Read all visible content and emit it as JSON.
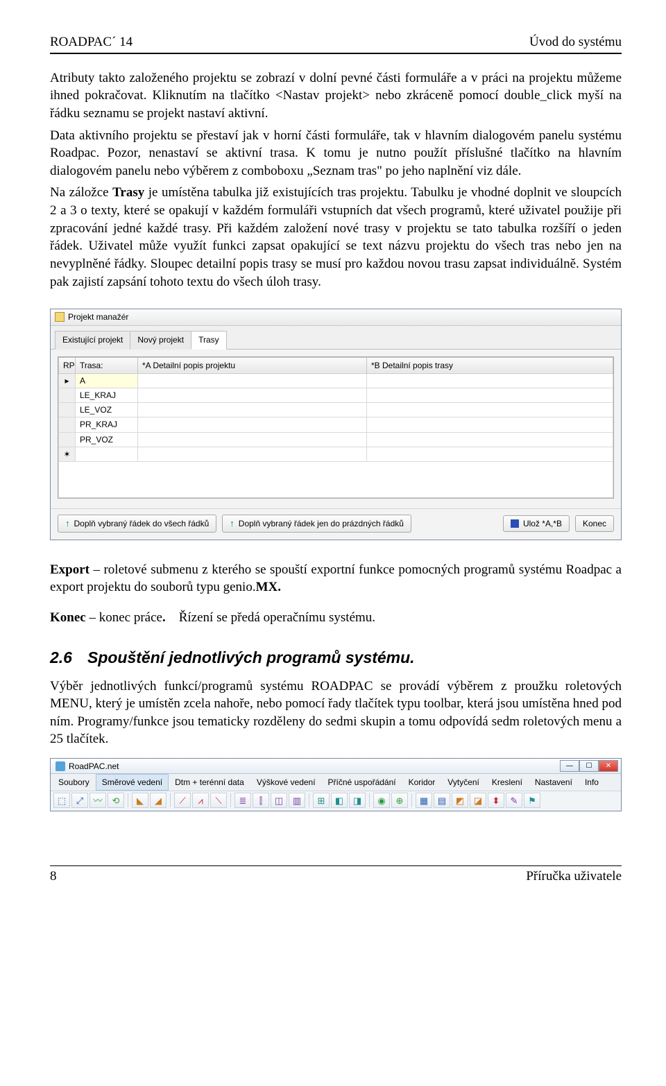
{
  "header": {
    "left": "ROADPAC´ 14",
    "right": "Úvod do systému"
  },
  "paragraphs": {
    "p1": "Atributy takto založeného projektu se zobrazí v dolní pevné části formuláře a v práci na projektu můžeme ihned pokračovat. Kliknutím na tlačítko <Nastav projekt> nebo zkráceně pomocí double_click myší na řádku seznamu se projekt nastaví aktivní.",
    "p2": "Data aktivního projektu se přestaví jak v horní části formuláře, tak v hlavním dialogovém panelu systému Roadpac. Pozor, nenastaví se aktivní trasa. K tomu je nutno použít příslušné tlačítko na hlavním dialogovém panelu nebo výběrem z comboboxu „Seznam tras\" po jeho naplnění viz dále.",
    "p3_pre": "Na záložce ",
    "p3_b": "Trasy",
    "p3_post": " je umístěna tabulka již existujících tras projektu. Tabulku je vhodné doplnit ve sloupcích 2 a 3 o texty, které se opakují v každém formuláři vstupních dat všech programů, které uživatel použije při zpracování jedné každé trasy. Při každém založení nové trasy v projektu se tato tabulka rozšíří o jeden řádek. Uživatel může využít funkci zapsat opakující se text názvu projektu do všech tras nebo jen na nevyplněné řádky. Sloupec detailní popis trasy se musí pro každou novou trasu zapsat individuálně. Systém pak zajistí zapsání tohoto textu do všech úloh trasy.",
    "export_b": "Export",
    "export_rest": " – roletové submenu z kterého se spouští exportní funkce pomocných programů systému Roadpac a export projektu do souborů typu genio.",
    "export_mx": "MX.",
    "konec_b": "Konec",
    "konec_rest1": " – konec práce",
    "konec_rest2": "Řízení se předá operačnímu systému.",
    "p_sec": "Výběr jednotlivých funkcí/programů systému ROADPAC se provádí výběrem z proužku  roletových MENU, který je umístěn zcela nahoře, nebo pomocí řady tlačítek typu toolbar, která jsou umístěna hned pod ním.  Programy/funkce jsou tematicky rozděleny do sedmi skupin a tomu odpovídá sedm roletových menu a 25 tlačítek."
  },
  "section": {
    "num": "2.6",
    "title": "Spouštění jednotlivých programů systému."
  },
  "pm": {
    "title": "Projekt manažér",
    "tabs": [
      "Existující projekt",
      "Nový projekt",
      "Trasy"
    ],
    "active_tab": 2,
    "columns": {
      "rp": "RP",
      "trasa": "Trasa:",
      "colA": "*A Detailní popis projektu",
      "colB": "*B Detailní popis trasy"
    },
    "rows": [
      "A",
      "LE_KRAJ",
      "LE_VOZ",
      "PR_KRAJ",
      "PR_VOZ"
    ],
    "buttons": {
      "fill_all": "Doplň vybraný řádek do všech řádků",
      "fill_empty": "Doplň vybraný řádek jen do prázdných řádků",
      "save": "Ulož *A,*B",
      "end": "Konec"
    }
  },
  "rp": {
    "title": "RoadPAC.net",
    "menu": [
      "Soubory",
      "Směrové vedení",
      "Dtm + terénní data",
      "Výškové vedení",
      "Příčné uspořádání",
      "Koridor",
      "Vytyčení",
      "Kreslení",
      "Nastavení",
      "Info"
    ],
    "active_menu": 1
  },
  "footer": {
    "page": "8",
    "label": "Příručka uživatele"
  }
}
